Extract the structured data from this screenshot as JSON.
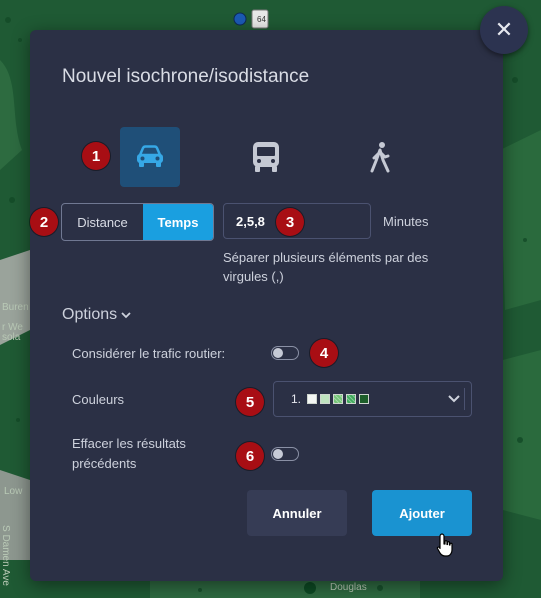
{
  "map": {
    "labels": [
      "Buren",
      "r We",
      "sola",
      "Low",
      "S Damen Ave",
      "Douglas"
    ],
    "shield_text": "64"
  },
  "dialog": {
    "close_glyph": "✕",
    "title": "Nouvel isochrone/isodistance",
    "modes": [
      "car",
      "bus",
      "walk"
    ],
    "active_mode": "car",
    "measure": {
      "options": [
        "Distance",
        "Temps"
      ],
      "selected": "Temps"
    },
    "input_value": "2,5,8",
    "unit": "Minutes",
    "hint": "Séparer plusieurs éléments par des virgules (,)",
    "options_label": "Options",
    "traffic_label": "Considérer le trafic routier:",
    "traffic_on": false,
    "colors_label": "Couleurs",
    "colors_index": "1.",
    "palette": [
      "#f4f7f4",
      "#bfe3bf",
      "#74c476",
      "#41ab5d",
      "#1d5e2a"
    ],
    "clear_label": "Effacer les résultats précédents",
    "clear_on": false,
    "cancel_label": "Annuler",
    "add_label": "Ajouter"
  },
  "annotations": [
    "1",
    "2",
    "3",
    "4",
    "5",
    "6"
  ],
  "colors": {
    "accent": "#1a9fe0",
    "badge": "#a80e14",
    "panel": "#2b3045"
  }
}
